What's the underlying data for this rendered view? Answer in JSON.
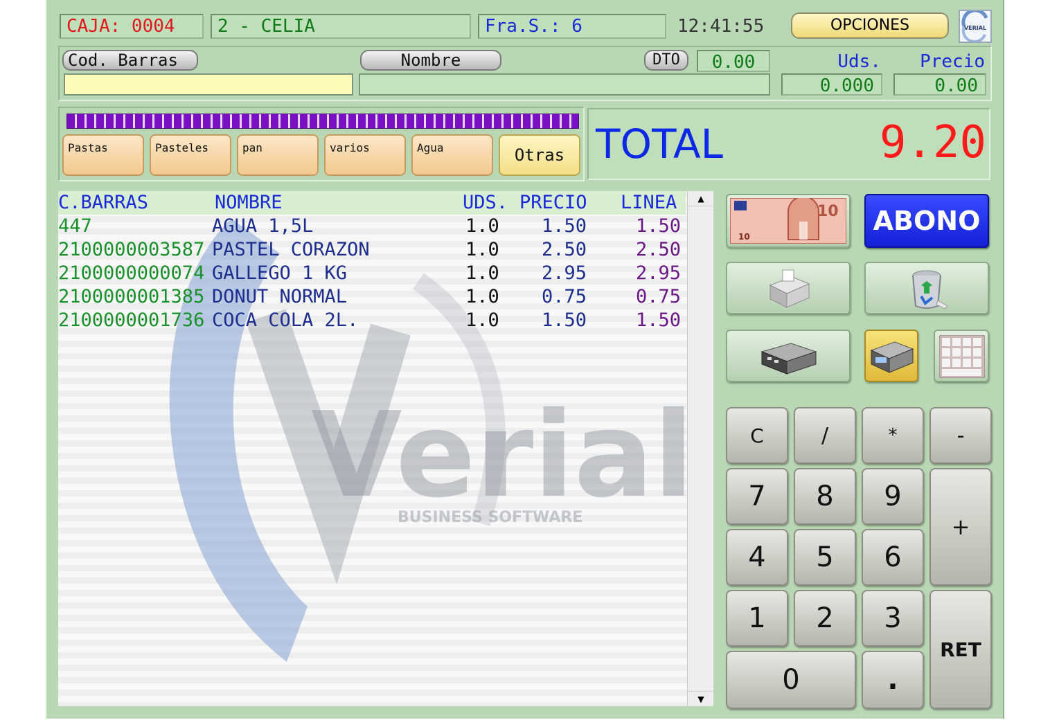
{
  "header": {
    "caja": "CAJA: 0004",
    "user": "2 - CELIA",
    "factura": "Fra.S.: 6",
    "time": "12:41:55",
    "options_label": "OPCIONES",
    "logo_text": "VERIAL"
  },
  "entry": {
    "barcode_label": "Cod. Barras",
    "barcode_value": "",
    "name_label": "Nombre",
    "name_value": "",
    "dto_label": "DTO",
    "dto_value": "0.00",
    "uds_label": "Uds.",
    "uds_value": "0.000",
    "precio_label": "Precio",
    "precio_value": "0.00"
  },
  "categories": [
    "Pastas",
    "Pasteles",
    "pan",
    "varios",
    "Agua",
    "Otras"
  ],
  "total": {
    "label": "TOTAL",
    "value": "9.20"
  },
  "table": {
    "headers": {
      "barcode": "C.BARRAS",
      "name": "NOMBRE",
      "uds": "UDS.",
      "price": "PRECIO",
      "line": "LINEA"
    },
    "rows": [
      {
        "barcode": "447",
        "name": "AGUA 1,5L",
        "uds": "1.0",
        "price": "1.50",
        "line": "1.50"
      },
      {
        "barcode": "2100000003587",
        "name": "PASTEL CORAZON",
        "uds": "1.0",
        "price": "2.50",
        "line": "2.50"
      },
      {
        "barcode": "2100000000074",
        "name": "GALLEGO 1 KG",
        "uds": "1.0",
        "price": "2.95",
        "line": "2.95"
      },
      {
        "barcode": "2100000001385",
        "name": "DONUT NORMAL",
        "uds": "1.0",
        "price": "0.75",
        "line": "0.75"
      },
      {
        "barcode": "2100000001736",
        "name": "COCA COLA 2L.",
        "uds": "1.0",
        "price": "1.50",
        "line": "1.50"
      }
    ],
    "watermark_brand": "Verial",
    "watermark_tagline": "BUSINESS SOFTWARE"
  },
  "actions": {
    "abono_label": "ABONO",
    "banknote_text": "10"
  },
  "keypad": {
    "c": "C",
    "slash": "/",
    "star": "*",
    "minus": "-",
    "k7": "7",
    "k8": "8",
    "k9": "9",
    "plus": "+",
    "k4": "4",
    "k5": "5",
    "k6": "6",
    "k1": "1",
    "k2": "2",
    "k3": "3",
    "ret": "RET",
    "k0": "0",
    "dot": "."
  },
  "colors": {
    "background": "#b9d7b5",
    "total_value": "#ff1a1a",
    "total_label": "#0a28e6",
    "abono": "#1a28e6"
  }
}
